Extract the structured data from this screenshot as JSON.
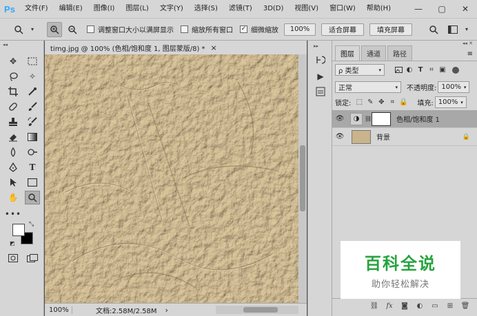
{
  "app": {
    "logo": "Ps"
  },
  "menu": [
    "文件(F)",
    "编辑(E)",
    "图像(I)",
    "图层(L)",
    "文字(Y)",
    "选择(S)",
    "滤镜(T)",
    "3D(D)",
    "视图(V)",
    "窗口(W)",
    "帮助(H)"
  ],
  "window_controls": {
    "minimize": "—",
    "restore": "▢",
    "close": "✕"
  },
  "options": {
    "resize_windows": "调整窗口大小以满屏显示",
    "zoom_all": "缩放所有窗口",
    "scrubby_zoom": "细微缩放",
    "zoom_value": "100%",
    "fit_screen": "适合屏幕",
    "fill_screen": "填充屏幕",
    "resize_checked": false,
    "zoom_all_checked": false,
    "scrubby_checked": true
  },
  "document": {
    "tab_title": "timg.jpg @ 100% (色相/饱和度 1, 图层蒙版/8) *",
    "close": "×",
    "zoom": "100%",
    "doc_info": "文档:2.58M/2.58M",
    "status_arrow": "›"
  },
  "layers_panel": {
    "tabs": [
      "图层",
      "通道",
      "路径"
    ],
    "filter_kind": "ρ 类型",
    "blend_mode": "正常",
    "opacity_label": "不透明度:",
    "opacity_value": "100%",
    "lock_label": "锁定:",
    "fill_label": "填充:",
    "fill_value": "100%",
    "layers": [
      {
        "name": "色相/饱和度 1",
        "visible": true,
        "selected": true
      },
      {
        "name": "背景",
        "visible": true,
        "selected": false,
        "locked": true
      }
    ]
  },
  "watermark": {
    "title": "百科全说",
    "subtitle": "助你轻松解决"
  },
  "colors": {
    "ui_bg": "#d6d6d6",
    "dark_bg": "#535353",
    "canvas_tan": "#c9b48c",
    "accent": "#31a8ff",
    "watermark_green": "#27a33e"
  },
  "icons": {
    "tools": [
      "move-icon",
      "marquee-icon",
      "lasso-icon",
      "magic-wand-icon",
      "crop-icon",
      "eyedropper-icon",
      "healing-icon",
      "brush-icon",
      "stamp-icon",
      "history-brush-icon",
      "eraser-icon",
      "gradient-icon",
      "blur-icon",
      "dodge-icon",
      "pen-icon",
      "type-icon",
      "path-select-icon",
      "shape-icon",
      "hand-icon",
      "zoom-icon"
    ]
  }
}
